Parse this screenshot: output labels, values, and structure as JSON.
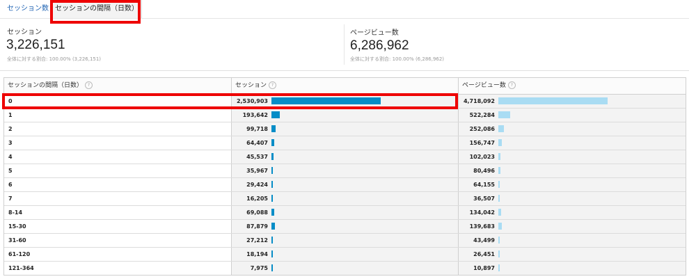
{
  "tabs": [
    "セッション数",
    "セッションの間隔（日数）"
  ],
  "metrics": [
    {
      "label": "セッション",
      "value": "3,226,151",
      "sub": "全体に対する割合: 100.00% (3,226,151)"
    },
    {
      "label": "ページビュー数",
      "value": "6,286,962",
      "sub": "全体に対する割合: 100.00% (6,286,962)"
    }
  ],
  "table": {
    "headers": [
      "セッションの間隔（日数）",
      "セッション",
      "ページビュー数"
    ],
    "help_icon": "?",
    "rows": [
      {
        "interval": "0",
        "sessions": "2,530,903",
        "pageviews": "4,718,092"
      },
      {
        "interval": "1",
        "sessions": "193,642",
        "pageviews": "522,284"
      },
      {
        "interval": "2",
        "sessions": "99,718",
        "pageviews": "252,086"
      },
      {
        "interval": "3",
        "sessions": "64,407",
        "pageviews": "156,747"
      },
      {
        "interval": "4",
        "sessions": "45,537",
        "pageviews": "102,023"
      },
      {
        "interval": "5",
        "sessions": "35,967",
        "pageviews": "80,496"
      },
      {
        "interval": "6",
        "sessions": "29,424",
        "pageviews": "64,155"
      },
      {
        "interval": "7",
        "sessions": "16,205",
        "pageviews": "36,507"
      },
      {
        "interval": "8-14",
        "sessions": "69,088",
        "pageviews": "134,042"
      },
      {
        "interval": "15-30",
        "sessions": "87,879",
        "pageviews": "139,683"
      },
      {
        "interval": "31-60",
        "sessions": "27,212",
        "pageviews": "43,499"
      },
      {
        "interval": "61-120",
        "sessions": "18,194",
        "pageviews": "26,451"
      },
      {
        "interval": "121-364",
        "sessions": "7,975",
        "pageviews": "10,897"
      }
    ]
  },
  "colors": {
    "sessions_bar": "#058dc7",
    "pageviews_bar": "#a9dcf3",
    "highlight": "#ee0000",
    "tab_link": "#2265b4"
  }
}
